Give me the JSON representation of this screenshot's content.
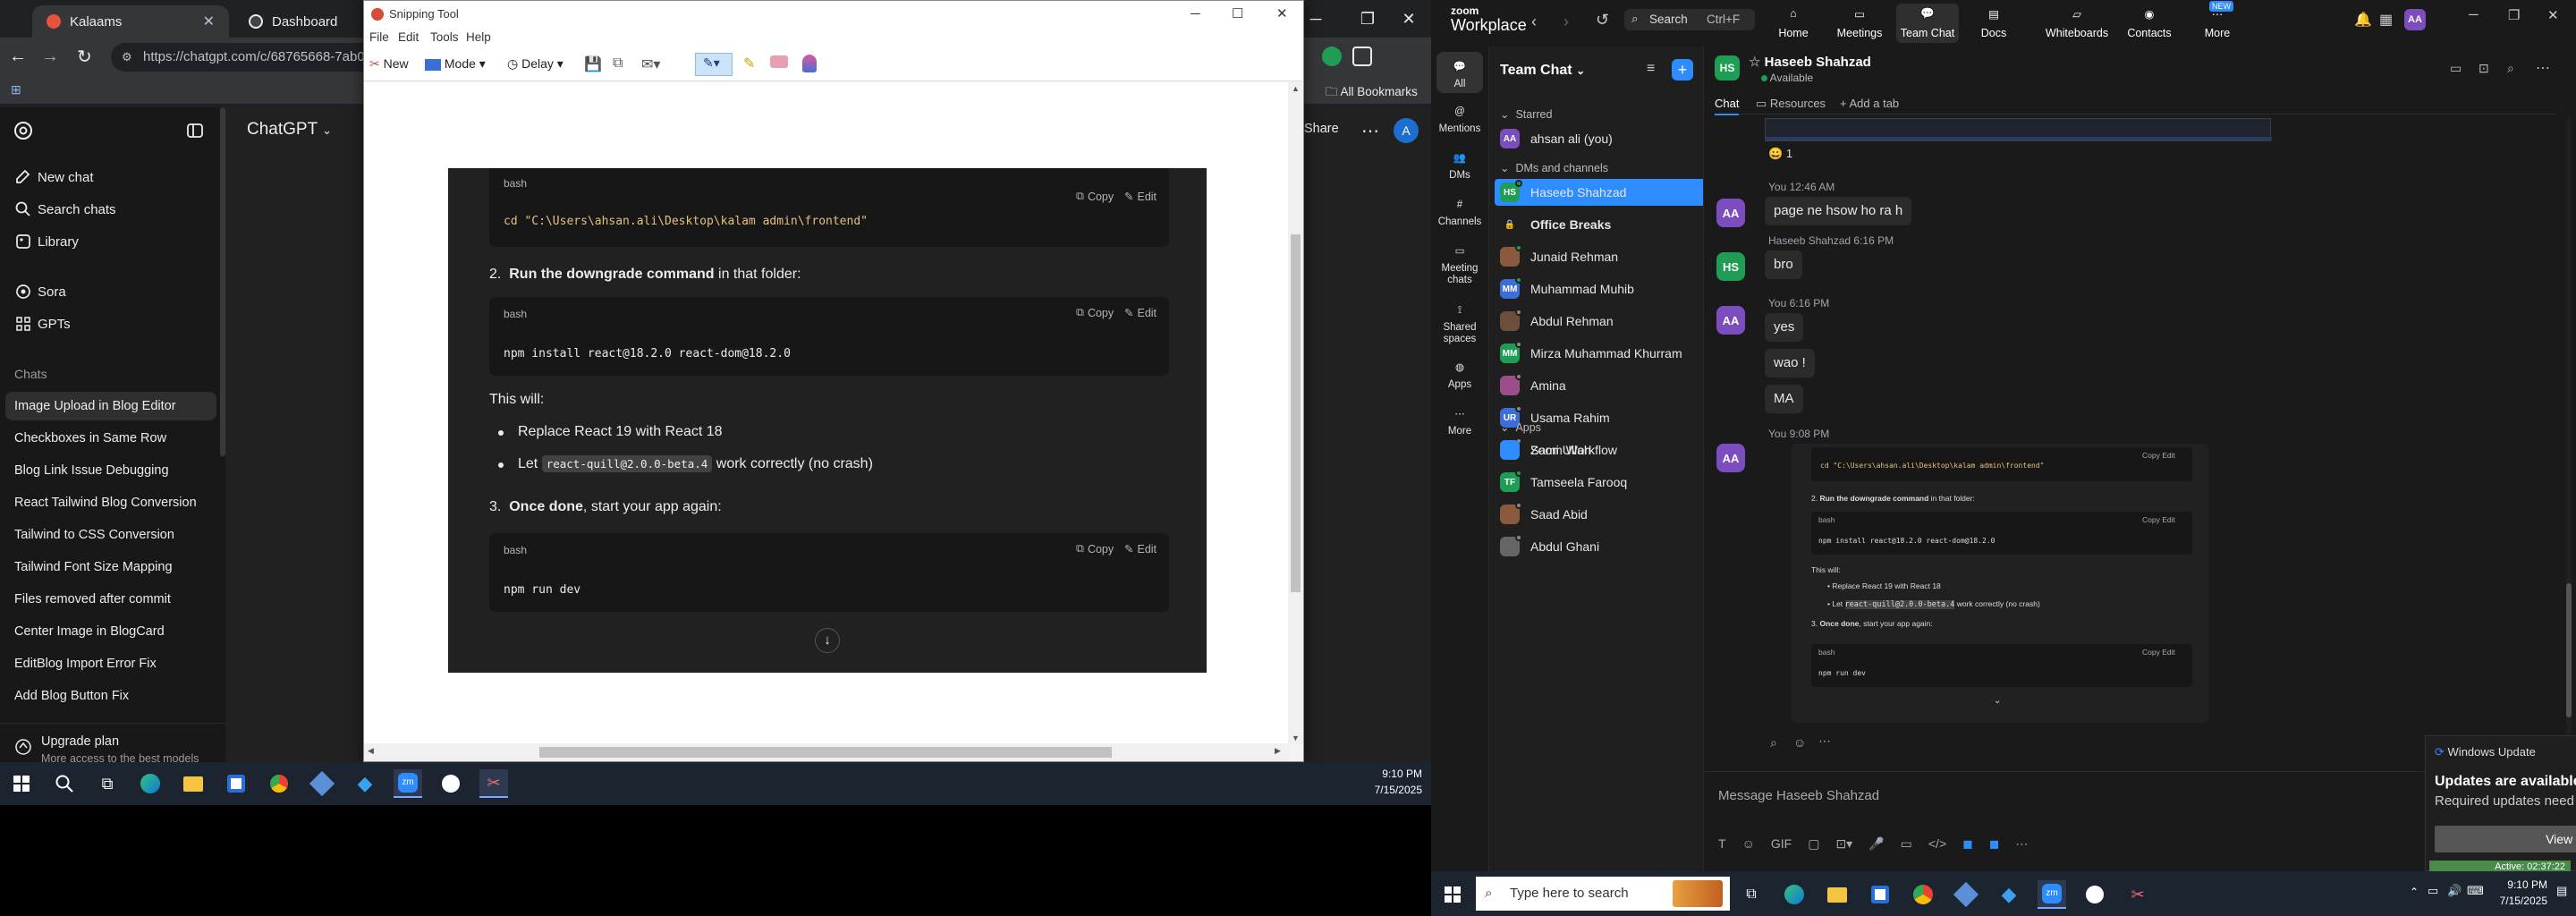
{
  "chrome": {
    "tab1": "Kalaams",
    "tab2": "Dashboard",
    "url": "https://chatgpt.com/c/68765668-7ab0-8",
    "bookmarks": "All Bookmarks"
  },
  "gpt": {
    "brand": "ChatGPT",
    "nav": [
      "New chat",
      "Search chats",
      "Library",
      "Sora",
      "GPTs"
    ],
    "chats_heading": "Chats",
    "chats": [
      "Image Upload in Blog Editor",
      "Checkboxes in Same Row",
      "Blog Link Issue Debugging",
      "React Tailwind Blog Conversion",
      "Tailwind to CSS Conversion",
      "Tailwind Font Size Mapping",
      "Files removed after commit",
      "Center Image in BlogCard",
      "EditBlog Import Error Fix",
      "Add Blog Button Fix"
    ],
    "upgrade_title": "Upgrade plan",
    "upgrade_sub": "More access to the best models",
    "share": "Share",
    "avatar": "A"
  },
  "snip": {
    "title": "Snipping Tool",
    "menu": [
      "File",
      "Edit",
      "Tools",
      "Help"
    ],
    "new_label": "New",
    "mode_label": "Mode",
    "delay_label": "Delay",
    "capture": {
      "top_lang": "bash",
      "copy": "Copy",
      "edit": "Edit",
      "cd_cmd": "cd \"C:\\Users\\ahsan.ali\\Desktop\\kalam admin\\frontend\"",
      "step2_num": "2.",
      "step2_bold": "Run the downgrade command",
      "step2_rest": " in that folder:",
      "lang": "bash",
      "npm_install": "npm install react@18.2.0 react-dom@18.2.0",
      "this_will": "This will:",
      "bullet1": "Replace React 19 with React 18",
      "bullet2_pre": "Let ",
      "bullet2_code": "react-quill@2.0.0-beta.4",
      "bullet2_post": " work correctly (no crash)",
      "step3_num": "3.",
      "step3_bold": "Once done",
      "step3_rest": ", start your app again:",
      "npm_dev": "npm run dev"
    }
  },
  "taskbar_left": {
    "time": "9:10 PM",
    "date": "7/15/2025"
  },
  "zoom": {
    "brand_top": "zoom",
    "brand": "Workplace",
    "search": "Search",
    "search_shortcut": "Ctrl+F",
    "nav": [
      "Home",
      "Meetings",
      "Team Chat",
      "Docs",
      "Whiteboards",
      "Contacts",
      "More"
    ],
    "new_badge": "NEW",
    "user_initials": "AA",
    "rail": [
      "All",
      "Mentions",
      "DMs",
      "Channels",
      "Meeting chats",
      "Shared spaces",
      "Apps",
      "More"
    ],
    "panel_title": "Team Chat",
    "starred": "Starred",
    "me": "ahsan ali (you)",
    "dms_heading": "DMs and channels",
    "contacts": [
      {
        "name": "Haseeb Shahzad",
        "initials": "HS",
        "color": "#1f9d55"
      },
      {
        "name": "Office Breaks",
        "initials": "",
        "color": "#444"
      },
      {
        "name": "Junaid Rehman",
        "initials": "",
        "color": "#8a5a3c"
      },
      {
        "name": "Muhammad Muhib",
        "initials": "MM",
        "color": "#3b6fd8"
      },
      {
        "name": "Abdul Rehman",
        "initials": "",
        "color": "#6b4f3a"
      },
      {
        "name": "Mirza Muhammad Khurram",
        "initials": "MM",
        "color": "#1f9d55"
      },
      {
        "name": "Amina",
        "initials": "",
        "color": "#9b4d8c"
      },
      {
        "name": "Usama Rahim",
        "initials": "UR",
        "color": "#3b6fd8"
      },
      {
        "name": "Sami Ullah",
        "initials": "",
        "color": "#b08a3a"
      },
      {
        "name": "Tamseela Farooq",
        "initials": "TF",
        "color": "#1f9d55"
      },
      {
        "name": "Saad Abid",
        "initials": "",
        "color": "#8a5a3c"
      },
      {
        "name": "Abdul Ghani",
        "initials": "",
        "color": "#666"
      }
    ],
    "apps_heading": "Apps",
    "app": "Zoom Workflow",
    "chat_name": "Haseeb Shahzad",
    "chat_initials": "HS",
    "chat_status": "Available",
    "chat_tabs": [
      "Chat",
      "Resources",
      "Add a tab"
    ],
    "messages": {
      "reaction": "1",
      "m1_meta": "You 12:46 AM",
      "m1": "page ne hsow ho ra h",
      "m2_meta": "Haseeb Shahzad 6:16 PM",
      "m2": "bro",
      "m3_meta": "You 6:16 PM",
      "m3a": "yes",
      "m3b": "wao !",
      "m3c": "MA",
      "m4_meta": "You 9:08 PM"
    },
    "compose_placeholder": "Message Haseeb Shahzad",
    "toast": {
      "app": "Windows Update",
      "title": "Updates are available",
      "body": "Required updates need to be downloaded.",
      "button": "View updates"
    },
    "active": "Active: 02:37:22"
  },
  "taskbar_right": {
    "search_placeholder": "Type here to search",
    "time": "9:10 PM",
    "date": "7/15/2025"
  }
}
